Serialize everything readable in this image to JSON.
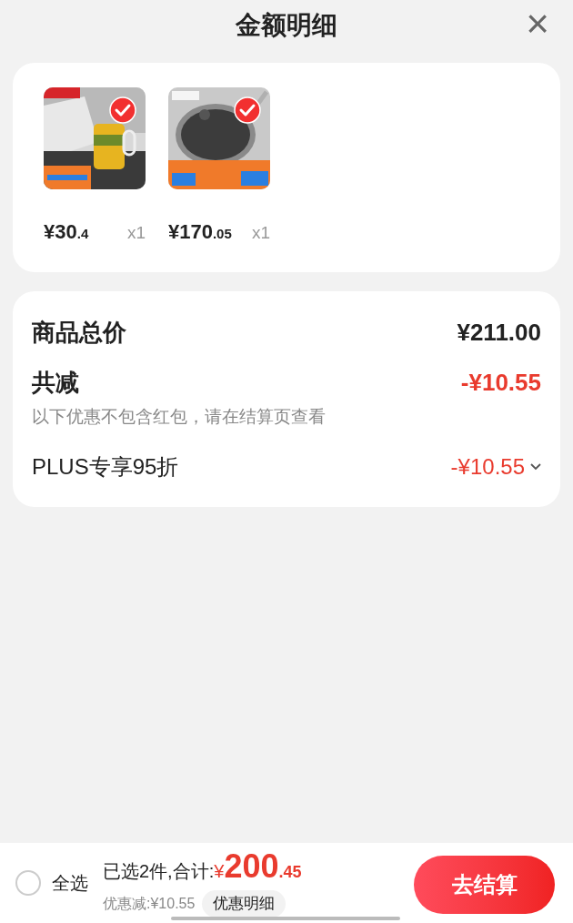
{
  "header": {
    "title": "金额明细",
    "close": "×"
  },
  "items": [
    {
      "kind": "picture",
      "checked": true,
      "price_main": "¥30",
      "price_decimal": ".4",
      "quantity": "x1"
    },
    {
      "kind": "picture",
      "checked": true,
      "price_main": "¥170",
      "price_decimal": ".05",
      "quantity": "x1"
    }
  ],
  "summary": {
    "total_label": "商品总价",
    "total_value": "¥211.00",
    "discount_label": "共减",
    "discount_value": "-¥10.55",
    "discount_note": "以下优惠不包含红包，请在结算页查看",
    "rows": [
      {
        "label": "PLUS专享95折",
        "value": "-¥10.55",
        "expanded": false
      }
    ]
  },
  "footer": {
    "select_all": {
      "label": "全选",
      "checked": false
    },
    "selected_text": "已选2件,合计:",
    "currency": "¥",
    "amount_main": "200",
    "amount_decimal": ".45",
    "saved": "优惠减:¥10.55",
    "detail_button": "优惠明细",
    "checkout": "去结算"
  }
}
